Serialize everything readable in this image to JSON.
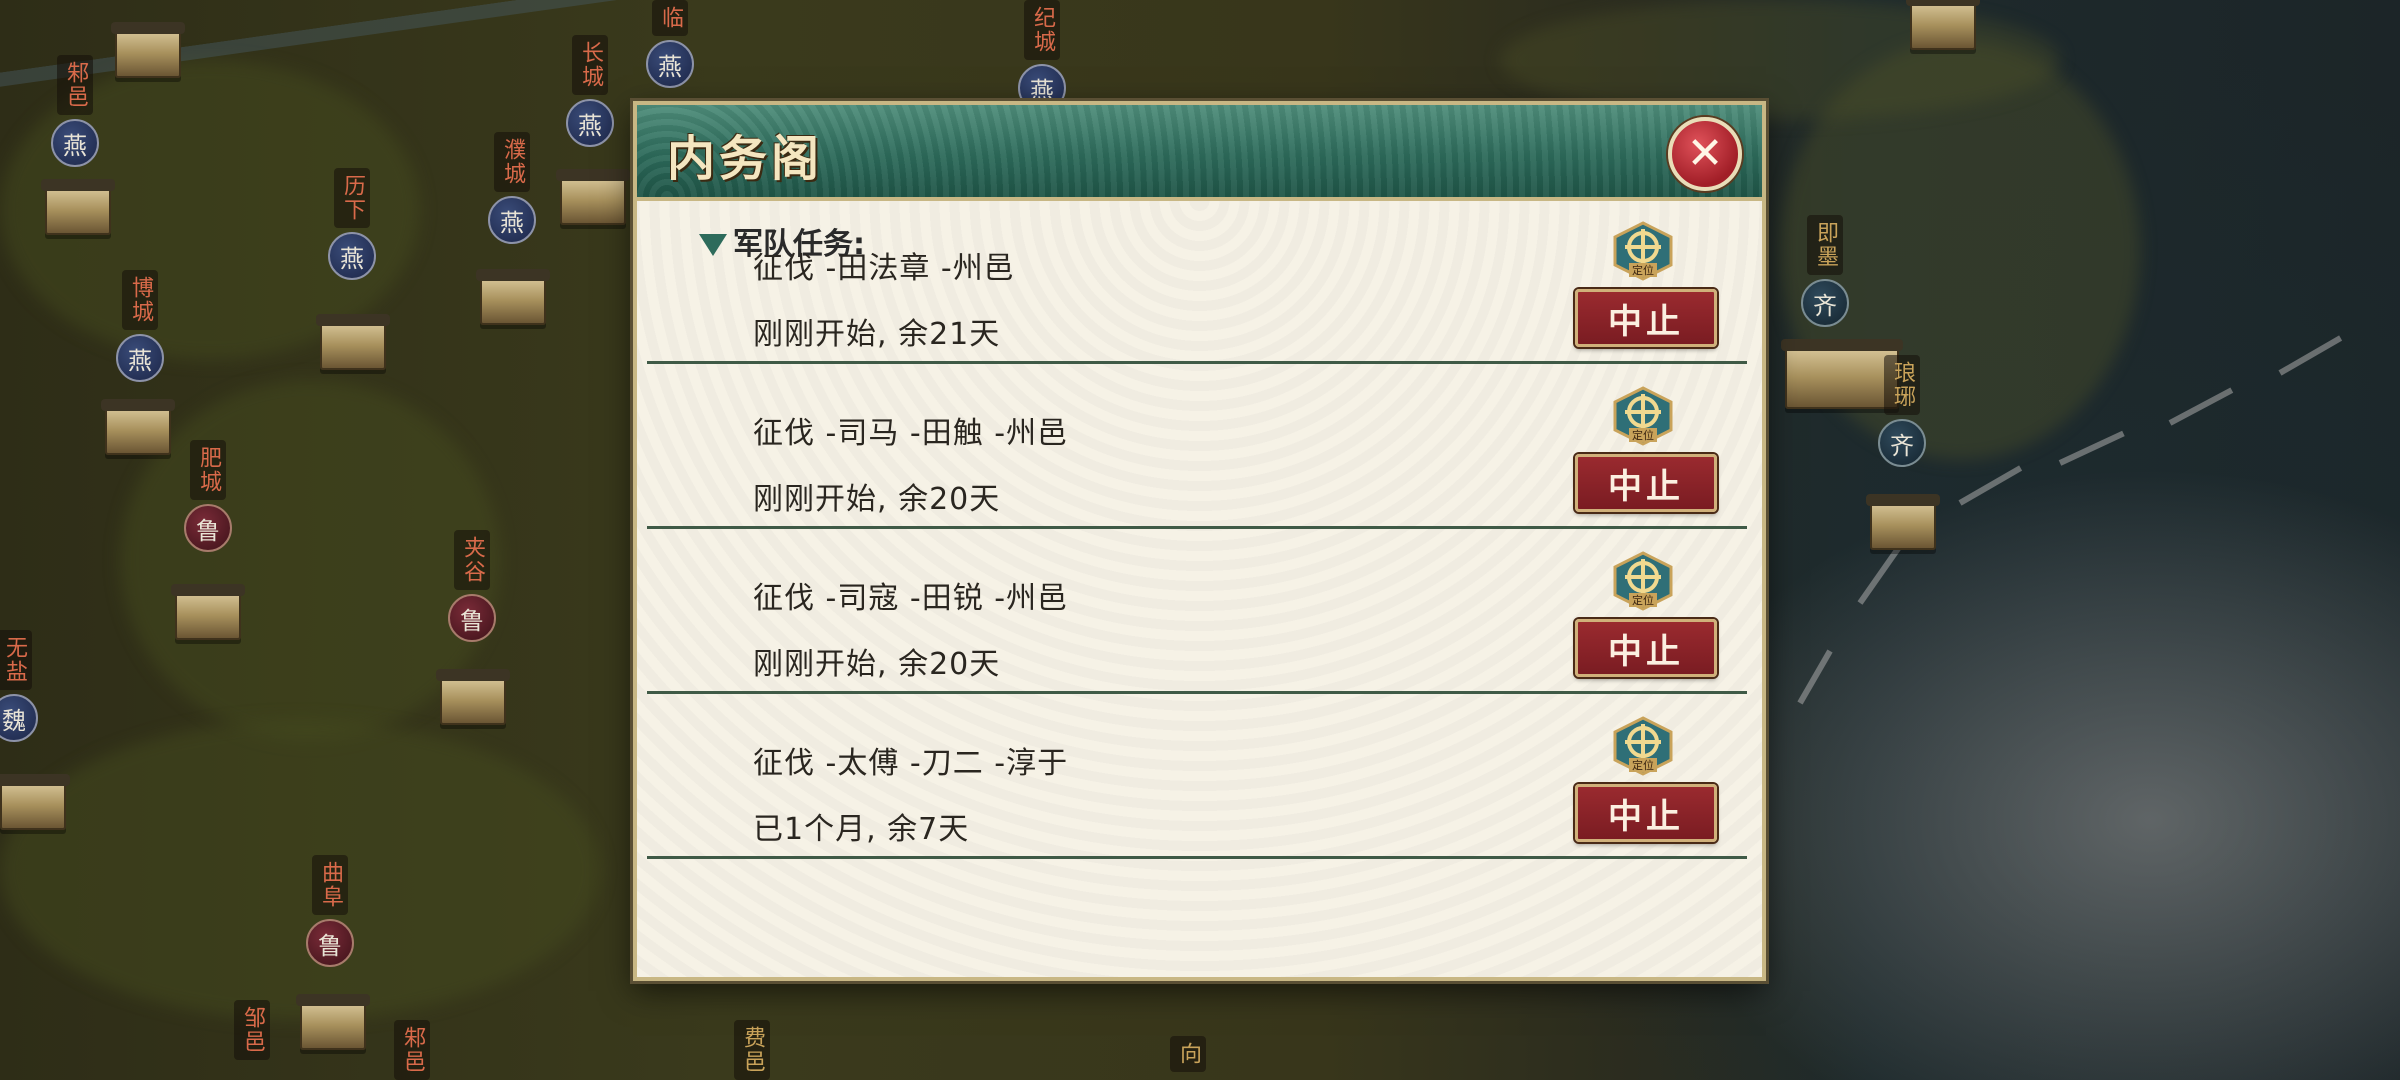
{
  "map": {
    "cities": [
      {
        "name": "邾邑",
        "faction": "燕",
        "style": "blue"
      },
      {
        "name": "长城",
        "faction": "燕",
        "style": "blue"
      },
      {
        "name": "临",
        "faction": "燕",
        "style": "blue"
      },
      {
        "name": "纪城",
        "faction": "燕",
        "style": "blue"
      },
      {
        "name": "历下",
        "faction": "燕",
        "style": "blue"
      },
      {
        "name": "濮城",
        "faction": "燕",
        "style": "blue"
      },
      {
        "name": "博城",
        "faction": "燕",
        "style": "blue"
      },
      {
        "name": "肥城",
        "faction": "鲁",
        "style": "red"
      },
      {
        "name": "夹谷",
        "faction": "鲁",
        "style": "red"
      },
      {
        "name": "曲阜",
        "faction": "鲁",
        "style": "red"
      },
      {
        "name": "无盐",
        "faction": "魏",
        "style": "blue"
      },
      {
        "name": "即墨",
        "faction": "齐",
        "style": "teal"
      },
      {
        "name": "琅琊",
        "faction": "齐",
        "style": "teal"
      },
      {
        "name": "邹邑",
        "faction": "",
        "style": "blue"
      },
      {
        "name": "邾邑",
        "faction": "",
        "style": "blue"
      },
      {
        "name": "费邑",
        "faction": "",
        "style": "blue"
      },
      {
        "name": "向",
        "faction": "",
        "style": "blue"
      }
    ]
  },
  "dialog": {
    "title": "内务阁",
    "close_icon": "close-icon",
    "section_label": "军队任务:",
    "tasks": [
      {
        "title": "征伐 -田法章 -州邑",
        "status": "刚刚开始, 余21天",
        "locate_label": "定位",
        "stop_label": "中止"
      },
      {
        "title": "征伐 -司马 -田触 -州邑",
        "status": "刚刚开始, 余20天",
        "locate_label": "定位",
        "stop_label": "中止"
      },
      {
        "title": "征伐 -司寇 -田锐 -州邑",
        "status": "刚刚开始, 余20天",
        "locate_label": "定位",
        "stop_label": "中止"
      },
      {
        "title": "征伐 -太傅 -刀二 -淳于",
        "status": "已1个月, 余7天",
        "locate_label": "定位",
        "stop_label": "中止"
      }
    ]
  },
  "colors": {
    "header_green": "#2d6b5b",
    "stop_red": "#8a2227",
    "panel_bg": "#f6f2e6",
    "close_red": "#c2303a"
  }
}
